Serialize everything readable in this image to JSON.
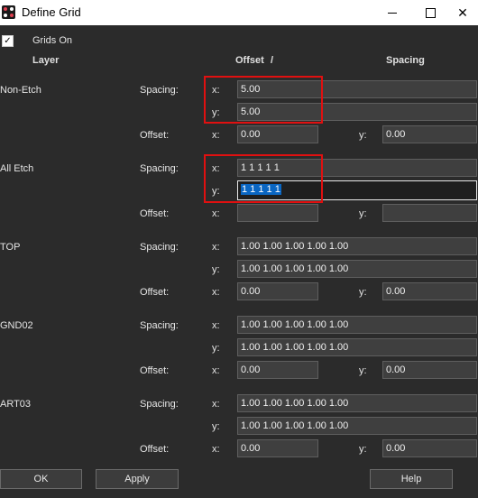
{
  "window": {
    "title": "Define Grid"
  },
  "controls": {
    "grids_on_label": "Grids On",
    "check_mark": "✓"
  },
  "headers": {
    "layer": "Layer",
    "offset": "Offset",
    "slash": "/",
    "spacing": "Spacing"
  },
  "labels": {
    "spacing": "Spacing:",
    "offset": "Offset:",
    "x": "x:",
    "y": "y:"
  },
  "layers": [
    {
      "name": "Non-Etch",
      "spacing_x": "5.00",
      "spacing_y": "5.00",
      "offset_x": "0.00",
      "offset_y": "0.00"
    },
    {
      "name": "All Etch",
      "spacing_x": "1 1 1 1 1",
      "spacing_y": "1 1 1 1 1",
      "offset_x": "",
      "offset_y": ""
    },
    {
      "name": "TOP",
      "spacing_x": "1.00 1.00 1.00 1.00 1.00",
      "spacing_y": "1.00 1.00 1.00 1.00 1.00",
      "offset_x": "0.00",
      "offset_y": "0.00"
    },
    {
      "name": "GND02",
      "spacing_x": "1.00 1.00 1.00 1.00 1.00",
      "spacing_y": "1.00 1.00 1.00 1.00 1.00",
      "offset_x": "0.00",
      "offset_y": "0.00"
    },
    {
      "name": "ART03",
      "spacing_x": "1.00 1.00 1.00 1.00 1.00",
      "spacing_y": "1.00 1.00 1.00 1.00 1.00",
      "offset_x": "0.00",
      "offset_y": "0.00"
    }
  ],
  "buttons": {
    "ok": "OK",
    "apply": "Apply",
    "help": "Help"
  },
  "colors": {
    "highlight": "#e01010",
    "selection": "#0a66c2",
    "background": "#2b2b2b"
  }
}
